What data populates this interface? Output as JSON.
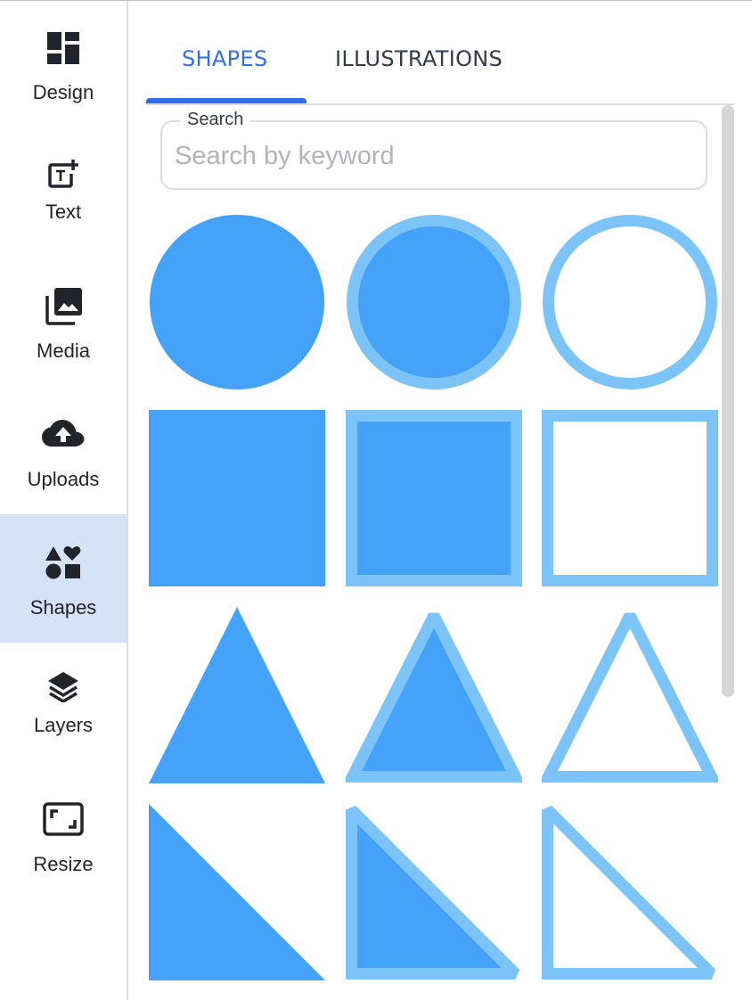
{
  "sidebar": {
    "items": [
      {
        "label": "Design",
        "icon": "design-grid-icon",
        "active": false
      },
      {
        "label": "Text",
        "icon": "add-text-icon",
        "active": false
      },
      {
        "label": "Media",
        "icon": "media-library-icon",
        "active": false
      },
      {
        "label": "Uploads",
        "icon": "cloud-upload-icon",
        "active": false
      },
      {
        "label": "Shapes",
        "icon": "shapes-icon",
        "active": true
      },
      {
        "label": "Layers",
        "icon": "layers-icon",
        "active": false
      },
      {
        "label": "Resize",
        "icon": "resize-icon",
        "active": false
      }
    ]
  },
  "tabs": [
    {
      "label": "SHAPES",
      "active": true
    },
    {
      "label": "ILLUSTRATIONS",
      "active": false
    }
  ],
  "search": {
    "label": "Search",
    "placeholder": "Search by keyword",
    "value": ""
  },
  "colors": {
    "accent": "#2f6fed",
    "shape_fill": "#44a2f8",
    "shape_stroke": "#7cc4f8",
    "active_nav_bg": "#d6e2f5"
  },
  "shapes": [
    {
      "name": "circle-filled",
      "kind": "circle",
      "style": "filled"
    },
    {
      "name": "circle-filled-outlined",
      "kind": "circle",
      "style": "filled-outlined"
    },
    {
      "name": "circle-outlined",
      "kind": "circle",
      "style": "outlined"
    },
    {
      "name": "square-filled",
      "kind": "square",
      "style": "filled"
    },
    {
      "name": "square-filled-outlined",
      "kind": "square",
      "style": "filled-outlined"
    },
    {
      "name": "square-outlined",
      "kind": "square",
      "style": "outlined"
    },
    {
      "name": "triangle-filled",
      "kind": "triangle",
      "style": "filled"
    },
    {
      "name": "triangle-filled-outlined",
      "kind": "triangle",
      "style": "filled-outlined"
    },
    {
      "name": "triangle-outlined",
      "kind": "triangle",
      "style": "outlined"
    },
    {
      "name": "right-triangle-filled",
      "kind": "right-triangle",
      "style": "filled"
    },
    {
      "name": "right-triangle-filled-outlined",
      "kind": "right-triangle",
      "style": "filled-outlined"
    },
    {
      "name": "right-triangle-outlined",
      "kind": "right-triangle",
      "style": "outlined"
    }
  ]
}
